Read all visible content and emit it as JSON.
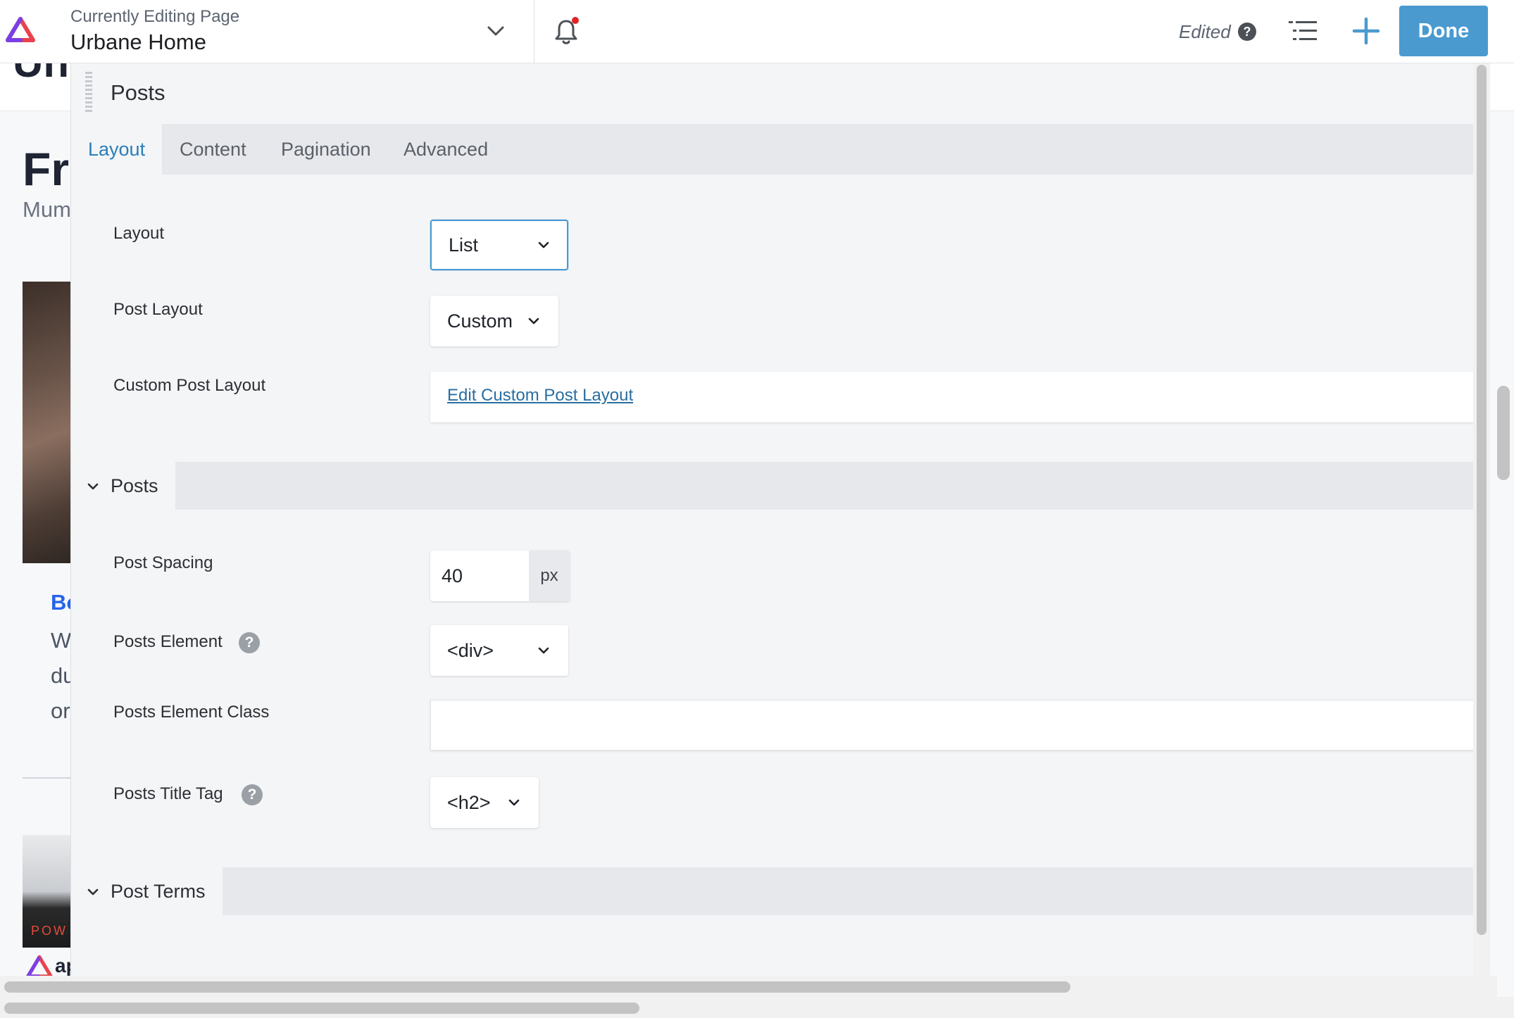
{
  "topbar": {
    "editing_label": "Currently Editing Page",
    "page_title": "Urbane Home",
    "status": "Edited",
    "help_glyph": "?",
    "done_label": "Done",
    "icons": [
      "builder-logo-icon",
      "chevron-down-icon",
      "bell-icon",
      "outline-list-icon",
      "plus-icon",
      "help-icon"
    ],
    "colors": {
      "accent": "#4a9ad0",
      "notification_dot": "#e02424"
    }
  },
  "background_page": {
    "heading_fragment": "Un",
    "title_fragment": "Fr",
    "subtitle_fragment": "Mum",
    "post_title_fragment": "Bo",
    "excerpt_lines": [
      "W",
      "du",
      "or"
    ],
    "image_text": "POW",
    "logo_text_fragment": "ap"
  },
  "panel": {
    "title": "Posts",
    "tabs": [
      {
        "label": "Layout",
        "active": true
      },
      {
        "label": "Content",
        "active": false
      },
      {
        "label": "Pagination",
        "active": false
      },
      {
        "label": "Advanced",
        "active": false
      }
    ],
    "layout_section": {
      "layout": {
        "label": "Layout",
        "value": "List"
      },
      "post_layout": {
        "label": "Post Layout",
        "value": "Custom"
      },
      "custom_post_layout": {
        "label": "Custom Post Layout",
        "link_text": "Edit Custom Post Layout"
      }
    },
    "posts_section": {
      "title": "Posts",
      "post_spacing": {
        "label": "Post Spacing",
        "value": "40",
        "unit": "px"
      },
      "posts_element": {
        "label": "Posts Element",
        "value": "<div>"
      },
      "posts_element_class": {
        "label": "Posts Element Class",
        "value": ""
      },
      "posts_title_tag": {
        "label": "Posts Title Tag",
        "value": "<h2>"
      }
    },
    "post_terms_section": {
      "title": "Post Terms"
    },
    "help_glyph": "?"
  }
}
